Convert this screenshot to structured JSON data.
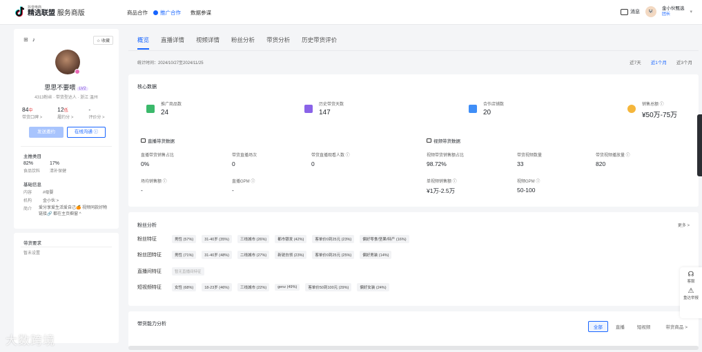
{
  "brand": {
    "small": "抖音电商",
    "main": "精选联盟",
    "sub": "服务商版"
  },
  "topnav": {
    "items": [
      {
        "label": "商品合作"
      },
      {
        "label": "推广合作",
        "active": true
      },
      {
        "label": "数据参谋"
      }
    ]
  },
  "top_right": {
    "message": "消息",
    "user_name": "金小伙甄选",
    "user_role": "团长"
  },
  "profile": {
    "favorite": "收藏",
    "name": "思思不要喂",
    "level": "LV2",
    "meta": "4313粉丝 · 带货型达人 · 浙江 温州",
    "stats": [
      {
        "value": "84",
        "suffix": "中",
        "label": "带货口碑 >"
      },
      {
        "value": "12",
        "suffix": "低",
        "label": "履约分 >"
      },
      {
        "value": "-",
        "suffix": "",
        "label": "评价分 >"
      }
    ],
    "btn_invite": "发送邀约",
    "btn_chat": "在线沟通",
    "main_cat_title": "主推类目",
    "cats": [
      {
        "value": "82%",
        "label": "食品饮料"
      },
      {
        "value": "17%",
        "label": "清补保健"
      }
    ],
    "basic_title": "基础信息",
    "basic": [
      {
        "k": "内容",
        "v": "#母婴"
      },
      {
        "k": "机构",
        "v": "金小伙 >"
      }
    ],
    "intro_k": "简介",
    "intro_v": "爱分享爱生活爱自己🍊 视频同款好物链接🔗 都在主页橱窗 ^"
  },
  "requirements": {
    "title": "带货要求",
    "value": "暂未设置"
  },
  "tabs": [
    {
      "label": "概览",
      "active": true
    },
    {
      "label": "直播详情"
    },
    {
      "label": "视频详情"
    },
    {
      "label": "粉丝分析"
    },
    {
      "label": "带货分析"
    },
    {
      "label": "历史带货评价"
    }
  ],
  "stat_time": "统计时间：2024/10/27至2024/11/25",
  "ranges": [
    {
      "label": "近7天"
    },
    {
      "label": "近1个月",
      "active": true
    },
    {
      "label": "近3个月"
    }
  ],
  "core": {
    "title": "核心数据",
    "items": [
      {
        "label": "推广商品数",
        "value": "24",
        "color": "#3bb96b"
      },
      {
        "label": "历史带货天数",
        "value": "147",
        "color": "#8a63e8"
      },
      {
        "label": "合作店铺数",
        "value": "20",
        "color": "#3f8ef7"
      },
      {
        "label": "销售总额 ⓘ",
        "value": "¥50万-75万",
        "color": "#f5b63b"
      }
    ]
  },
  "live": {
    "title": "直播带货数据",
    "metrics": [
      {
        "label": "直播带货销售占比",
        "value": "0%"
      },
      {
        "label": "带货直播场次",
        "value": "0"
      },
      {
        "label": "带货直播观看人数 ⓘ",
        "value": "0"
      },
      {
        "label": "场均销售额 ⓘ",
        "value": "-"
      },
      {
        "label": "直播GPM ⓘ",
        "value": "-"
      }
    ]
  },
  "video": {
    "title": "视频带货数据",
    "metrics": [
      {
        "label": "视频带货销售额占比",
        "value": "98.72%"
      },
      {
        "label": "带货视频数量",
        "value": "33"
      },
      {
        "label": "带货视频播放量 ⓘ",
        "value": "820"
      },
      {
        "label": "单视频销售额 ⓘ",
        "value": "¥1万-2.5万"
      },
      {
        "label": "视频GPM ⓘ",
        "value": "50-100"
      }
    ]
  },
  "fans": {
    "title": "粉丝分析",
    "more": "更多 >",
    "rows": [
      {
        "label": "粉丝特征",
        "tags": [
          "男性 (57%)",
          "31-40岁 (35%)",
          "三线城市 (26%)",
          "都市银发 (42%)",
          "客单价0到25元 (23%)",
          "偏好零食/坚果/特产 (16%)"
        ]
      },
      {
        "label": "粉丝团特征",
        "tags": [
          "男性 (71%)",
          "31-40岁 (48%)",
          "二线城市 (27%)",
          "新锐白领 (23%)",
          "客单价0到25元 (25%)",
          "偏好男装 (14%)"
        ]
      },
      {
        "label": "直播间特征",
        "tags": [
          "暂无直播间特征"
        ],
        "muted": true
      },
      {
        "label": "短视频特征",
        "tags": [
          "女性 (68%)",
          "18-23岁 (46%)",
          "三线城市 (22%)",
          "genz (49%)",
          "客单价50到100元 (29%)",
          "偏好女装 (24%)"
        ]
      }
    ]
  },
  "ability": {
    "title": "带货能力分析",
    "segments": [
      {
        "label": "全部",
        "active": true
      },
      {
        "label": "直播"
      },
      {
        "label": "短视频"
      }
    ],
    "more": "带货商品 >"
  },
  "side_float": {
    "service": "客服",
    "report": "重达举报"
  },
  "watermark": "大数跨境"
}
